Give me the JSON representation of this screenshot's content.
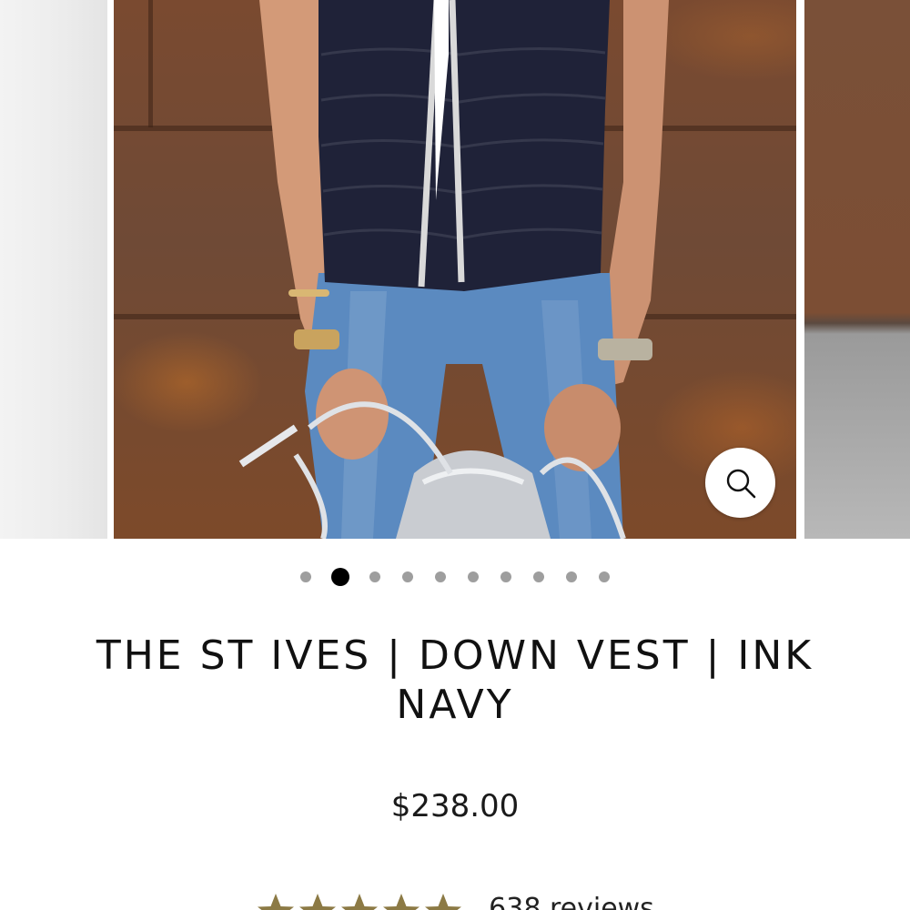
{
  "product": {
    "title": "THE ST IVES | DOWN VEST | INK NAVY",
    "price": "$238.00"
  },
  "gallery": {
    "current_index": 2,
    "total_slides": 10,
    "zoom_icon": "magnifier-icon"
  },
  "reviews": {
    "rating_fraction": 0.9,
    "count_label": "638 reviews"
  },
  "colors": {
    "star": "#8c7a45",
    "active_dot": "#000000",
    "dot": "#9e9e9e",
    "vest": "#1f2238"
  }
}
